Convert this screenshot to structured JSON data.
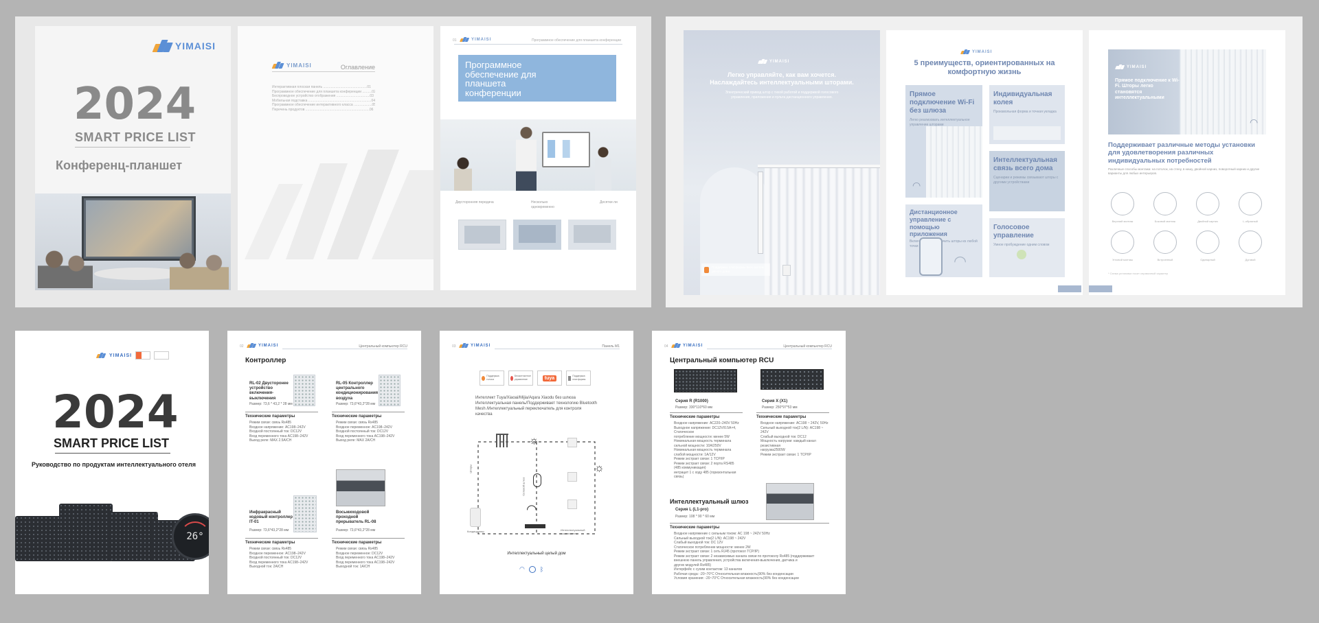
{
  "brand": "YIMAISI",
  "spread1": {
    "cover": {
      "year": "2024",
      "title": "SMART PRICE LIST",
      "subtitle": "Конференц-планшет"
    },
    "toc": {
      "heading": "Оглавление",
      "lines": [
        "Интерактивная плоская панель ..............................................01",
        "Программное обеспечение для планшета конференции ..........02",
        "Беспроводное устройство отображения ...................................03",
        "Мобильная подставка ..................................................................04",
        "Программное обеспечение интерактивного класса ...................05",
        "Перечень продуктов ...................................................................06"
      ]
    },
    "software": {
      "header_right": "Программное обеспечение для планшета конференции",
      "banner": "Программное обеспечение для планшета конференции",
      "features": [
        "Двусторонняя передача",
        "Несколько одновременно",
        "Десятки ли"
      ]
    }
  },
  "spread2": {
    "curtain": {
      "headline": "Легко управляйте, как вам хочется. Наслаждайтесь интеллектуальными шторами.",
      "body": "Электрический привод штор с тихой работой и поддержкой голосового управления, приложения и пульта дистанционного управления.",
      "badge": "Поддержка платформы всех систем умного дома"
    },
    "advantages": {
      "title": "5 преимуществ, ориентированных на комфортную жизнь",
      "items": [
        {
          "h": "Прямое подключение Wi-Fi без шлюза",
          "t": "Легко реализовать интеллектуальное управление шторами"
        },
        {
          "h": "Индивидуальная колея",
          "t": "Произвольная форма и точная укладка"
        },
        {
          "h": "Интеллектуальная связь всего дома",
          "t": "Сценарии и режимы связывают шторы с другими устройствами"
        },
        {
          "h": "Дистанционное управление с помощью приложения",
          "t": "Включить или выключить шторы из любой точки"
        },
        {
          "h": "Голосовое управление",
          "t": "Умное пробуждение одним словом"
        }
      ]
    },
    "install": {
      "hero_title": "Прямое подключение к Wi-Fi. Шторы легко становятся интеллектуальными",
      "title": "Поддерживает различные методы установки для удовлетворения различных индивидуальных потребностей",
      "body": "Различные способы монтажа: на потолок, на стену, в нишу, двойной карниз, поворотный карниз и другие варианты для любых интерьеров.",
      "icons": [
        "Верхний монтаж",
        "Боковой монтаж",
        "Двойной карниз",
        "L-образный",
        "Угловой монтаж",
        "Встроенный",
        "Одинарный",
        "Дуговой"
      ],
      "footer": "* Схема установки носит справочный характер"
    }
  },
  "row2": {
    "hotel": {
      "year": "2024",
      "title": "SMART PRICE LIST",
      "subtitle": "Руководство по продуктам интеллектуального отеля",
      "display": "26°"
    },
    "controller": {
      "header_right": "Центральный компьютер RCU",
      "title": "Контроллер",
      "items": [
        {
          "name": "RL-02 Двусторонее устройство включения-выключения",
          "size": "Размер: 73,6 * 43,2 * 28 мм",
          "spec_head": "Технические параметры",
          "specs": [
            "Режим связи: связь Rs485",
            "Входное напряжение: AC198–242V",
            "Входной постоянный ток: DC12V",
            "Вход переменного тока AC198–242V",
            "Выход реле: MAX 2.5A/CH"
          ]
        },
        {
          "name": "RL-05 Контроллер центрального кондиционирования воздуха",
          "size": "Размер: 73,6*43,2*28 мм",
          "spec_head": "Технические параметры",
          "specs": [
            "Режим связи: связь Rs485",
            "Входное переменное: AC198–242V",
            "Входной постоянный ток: DC12V",
            "Вход переменного тока AC198–242V",
            "Выход реле: MAX 2A/CH"
          ]
        },
        {
          "name": "Инфракрасный кодовый контроллер IT-01",
          "size": "Размер: 73,6*43,2*28 мм",
          "spec_head": "Технические параметры",
          "specs": [
            "Режим связи: связь Rs485",
            "Входное переменное: AC198–242V",
            "Входной постоянный ток: DC12V",
            "Вход переменного тока AC198–242V",
            "Выходной ток: 2A/CH"
          ]
        },
        {
          "name": "Восьмиходовой проходной прерыватель RL-08",
          "size": "Размер: 73,6*43,2*28 мм",
          "spec_head": "Технические параметры",
          "specs": [
            "Режим связи: связь Rs485",
            "Входное переменное: DC12V",
            "Вход переменного тока AC198–242V",
            "Вход переменного тока AC198–242V",
            "Выходной ток: 1A/CH"
          ]
        }
      ]
    },
    "panel": {
      "header_right": "Панель M1",
      "badges": [
        "Поддержка голоса",
        "Бесконтактное управление",
        "tuya",
        "Поддержка платформы"
      ],
      "desc": "Интеллект Tuya/Xiaoai/Mijia/Aqara Xiaodu без шлюза Интеллектуальная панель/Поддерживает технологию Bluetooth Mesh /Интеллектуальный переключатель для контроля качества",
      "caption": "Интеллектуальный целый дом",
      "labels": [
        "Интеллектуальный выключатель",
        "Шторы",
        "Сетевой шлюз",
        "Кондиционер"
      ]
    },
    "rcu": {
      "header_right": "Центральный компьютер RCU",
      "title": "Центральный компьютер RCU",
      "series_r": {
        "name": "Серия R (R1000)",
        "size": "Размер: 330*110*60 мм"
      },
      "series_x": {
        "name": "Серия X (X1)",
        "size": "Размер: 250*97*53 мм"
      },
      "spec_head": "Технические параметры",
      "specs_r": [
        "Входное напряжение: AC220–240V 50Hz",
        "Выходное напряжение: DC12V/0.5A×4, Статическое",
        "потребление мощности: менее 5W",
        "Номинальная мощность терминала",
        "сильной мощности: 10A/250V",
        "Номинальная мощность терминала",
        "слабой мощности: 1A/12V",
        "Режим экстракт связи: 1 TCP/IP",
        "Режим экстракт связи: 2 порта RS485",
        "(485 коммуникация)",
        "интрацет 1 с ходу 485 (горизонтальная связь)"
      ],
      "specs_x": [
        "Входное напряжение: AC198 ~ 242V, 50Hz",
        "Сильный выходной ток(2 L/N): AC198 ~ 242V",
        "Слабый выходной ток: DC12",
        "Мощность нагрузки: каждый канал резистивная",
        "нагрузка2500W",
        "Режим экстракт связи: 1 TCP/IP"
      ],
      "gateway_title": "Интеллектуальный шлюз",
      "series_l": {
        "name": "Серия L (L1-pro)",
        "size": "Размер: 108 * 90 * 60 мм"
      },
      "specs_l": [
        "Входное напряжение с сильным током: AC 198 ~ 242V 50Hz",
        "Сильный выходной ток(2 L/N): AC198 ~ 242V",
        "Слабый выходной ток: DC 12V",
        "Статическое потребление мощности: менее 2W",
        "Режим экстракт связи: 1 сеть RJ45 (протокол TCP/IP)",
        "Режим экстракт связи: 2 независимых канала связи по протоколу Rs485 (поддерживает",
        "внешнюю панель управления, устройства включения-выключения, датчика и",
        "других модулей Rs485)",
        "Интерфейс с сухим контактом: 13 каналов",
        "Рабочая среда: -20~70°C Относительная влажность(90% без конденсации",
        "Условия хранения: -20~70°C Относительная влажность(90% без конденсации"
      ]
    }
  }
}
